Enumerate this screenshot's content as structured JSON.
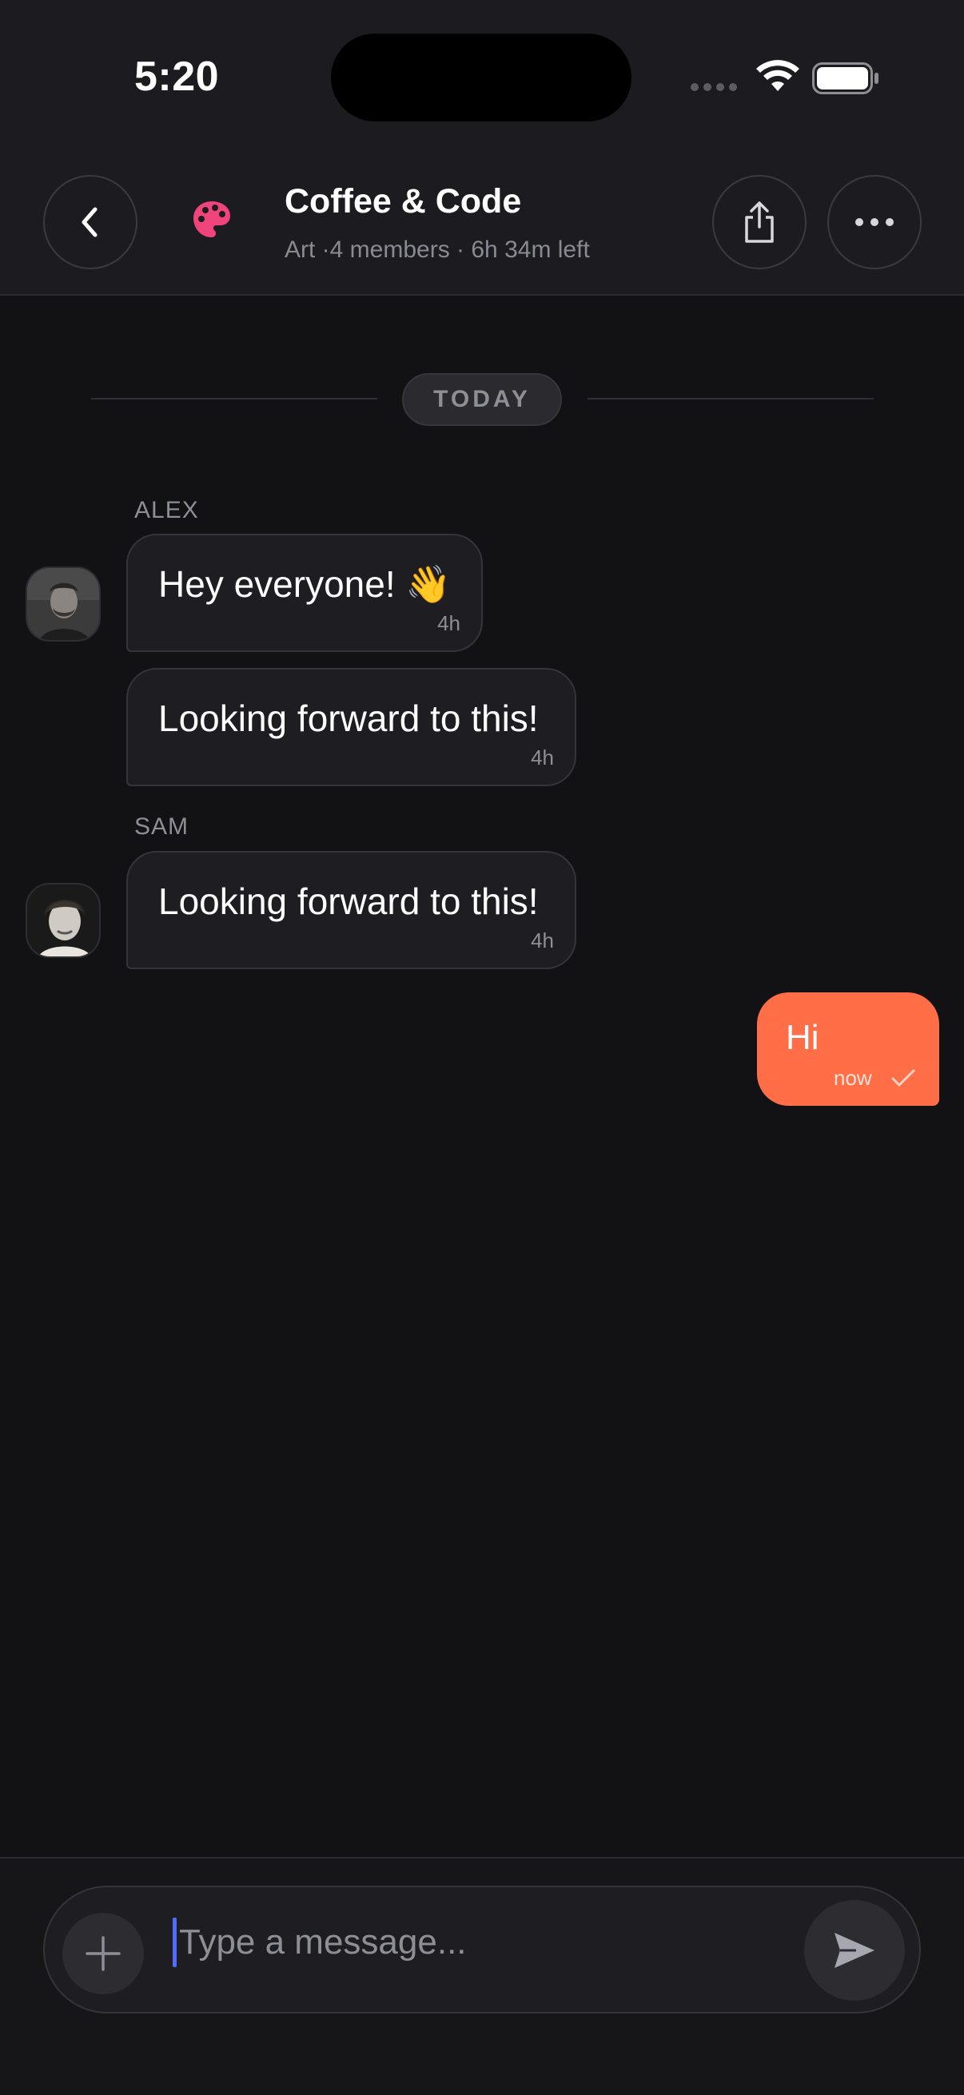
{
  "status_bar": {
    "time": "5:20"
  },
  "header": {
    "title": "Coffee & Code",
    "subtitle": "Art ·4 members · 6h 34m left"
  },
  "date_divider": "TODAY",
  "messages": [
    {
      "sender": "ALEX",
      "text": "Hey everyone! 👋",
      "time": "4h"
    },
    {
      "text": "Looking forward to this!",
      "time": "4h"
    },
    {
      "sender": "SAM",
      "text": "Looking forward to this!",
      "time": "4h"
    }
  ],
  "my_message": {
    "text": "Hi",
    "time": "now"
  },
  "composer": {
    "placeholder": "Type a message..."
  },
  "colors": {
    "accent": "#ff6e47",
    "palette_icon": "#f0447c",
    "caret": "#4f6cff"
  }
}
